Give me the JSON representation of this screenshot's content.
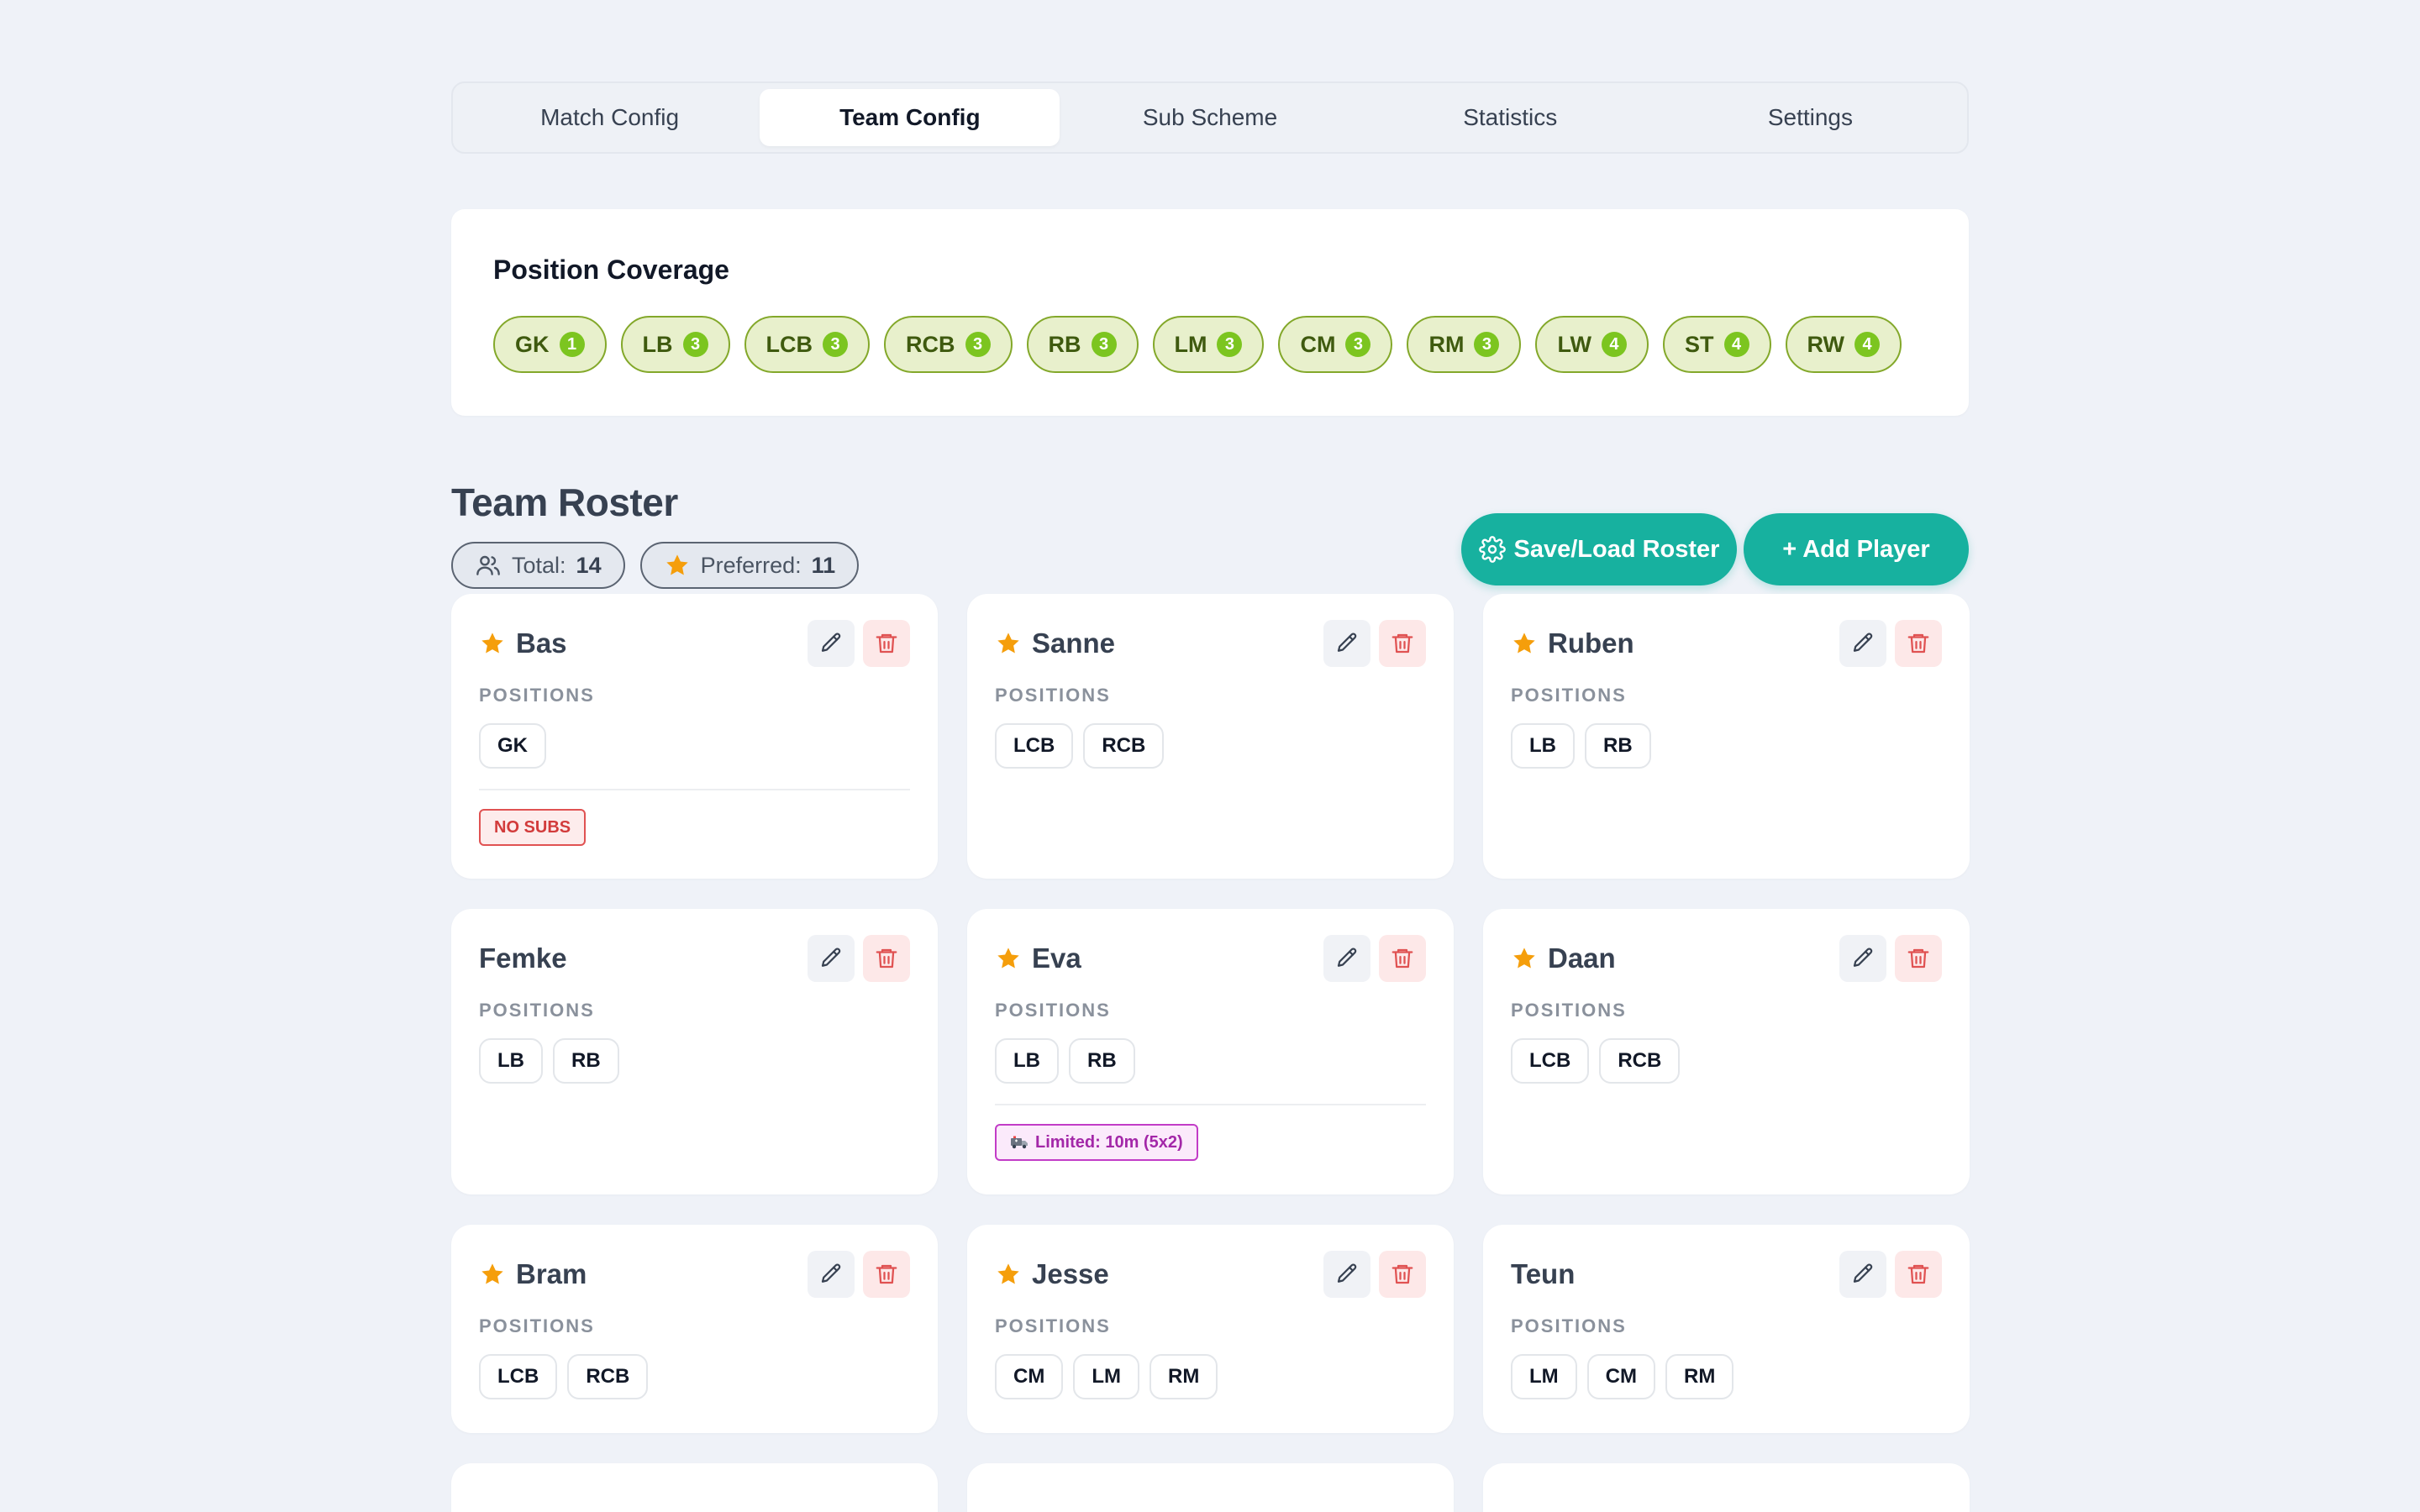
{
  "tabs": [
    {
      "label": "Match Config",
      "active": false
    },
    {
      "label": "Team Config",
      "active": true
    },
    {
      "label": "Sub Scheme",
      "active": false
    },
    {
      "label": "Statistics",
      "active": false
    },
    {
      "label": "Settings",
      "active": false
    }
  ],
  "coverage": {
    "title": "Position Coverage",
    "chips": [
      {
        "pos": "GK",
        "count": "1"
      },
      {
        "pos": "LB",
        "count": "3"
      },
      {
        "pos": "LCB",
        "count": "3"
      },
      {
        "pos": "RCB",
        "count": "3"
      },
      {
        "pos": "RB",
        "count": "3"
      },
      {
        "pos": "LM",
        "count": "3"
      },
      {
        "pos": "CM",
        "count": "3"
      },
      {
        "pos": "RM",
        "count": "3"
      },
      {
        "pos": "LW",
        "count": "4"
      },
      {
        "pos": "ST",
        "count": "4"
      },
      {
        "pos": "RW",
        "count": "4"
      }
    ]
  },
  "roster": {
    "title": "Team Roster",
    "total_label": "Total:",
    "total_value": "14",
    "preferred_label": "Preferred:",
    "preferred_value": "11",
    "save_label": "Save/Load Roster",
    "add_label": "+ Add Player",
    "positions_label": "POSITIONS"
  },
  "players": [
    {
      "name": "Bas",
      "preferred": true,
      "positions": [
        "GK"
      ],
      "tag": {
        "type": "nosubs",
        "text": "NO SUBS"
      }
    },
    {
      "name": "Sanne",
      "preferred": true,
      "positions": [
        "LCB",
        "RCB"
      ]
    },
    {
      "name": "Ruben",
      "preferred": true,
      "positions": [
        "LB",
        "RB"
      ]
    },
    {
      "name": "Femke",
      "preferred": false,
      "positions": [
        "LB",
        "RB"
      ]
    },
    {
      "name": "Eva",
      "preferred": true,
      "positions": [
        "LB",
        "RB"
      ],
      "tag": {
        "type": "limited",
        "text": "Limited: 10m (5x2)"
      }
    },
    {
      "name": "Daan",
      "preferred": true,
      "positions": [
        "LCB",
        "RCB"
      ]
    },
    {
      "name": "Bram",
      "preferred": true,
      "positions": [
        "LCB",
        "RCB"
      ]
    },
    {
      "name": "Jesse",
      "preferred": true,
      "positions": [
        "CM",
        "LM",
        "RM"
      ]
    },
    {
      "name": "Teun",
      "preferred": false,
      "positions": [
        "LM",
        "CM",
        "RM"
      ]
    }
  ],
  "colors": {
    "accent": "#17b19f",
    "star": "#f59e0b",
    "delete": "#e05252",
    "chip_border": "#83a82a",
    "chip_badge": "#7cc520"
  },
  "icons": {
    "star": "star-icon",
    "edit": "pencil-icon",
    "delete": "trash-icon",
    "users": "users-icon",
    "gear": "gear-icon",
    "ambulance": "ambulance-icon"
  }
}
